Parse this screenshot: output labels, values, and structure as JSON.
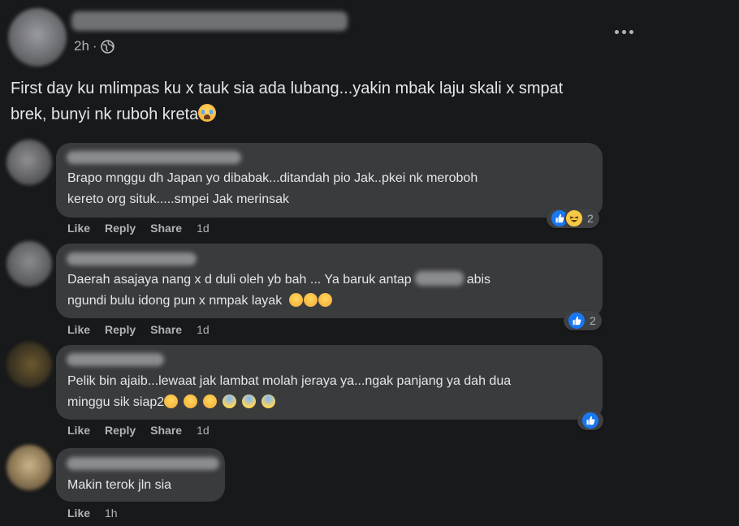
{
  "post": {
    "time": "2h",
    "dot": "·",
    "privacy_icon": "globe-icon",
    "text_line1": "First day ku mlimpas ku x tauk sia ada lubang...yakin mbak laju skali x smpat",
    "text_line2": "brek, bunyi nk ruboh kreta",
    "text_emoji": "crying-face-emoji",
    "more_icon": "more-horizontal-icon"
  },
  "actions": {
    "like": "Like",
    "reply": "Reply",
    "share": "Share"
  },
  "comments": [
    {
      "line1": "Brapo mnggu dh Japan yo dibabak...ditandah pio Jak..pkei nk meroboh",
      "line2": "kereto org situk.....smpei Jak merinsak",
      "time": "1d",
      "reaction_count": "2",
      "reactions": [
        "like",
        "haha"
      ]
    },
    {
      "line1_a": "Daerah asajaya nang x d duli oleh yb bah ... Ya baruk antap",
      "line1_b": "abis",
      "line2": "ngundi bulu idong pun x nmpak layak",
      "line2_emojis": [
        "rofl-emoji",
        "rofl-emoji",
        "rofl-emoji"
      ],
      "time": "1d",
      "reaction_count": "2",
      "reactions": [
        "like"
      ]
    },
    {
      "line1": "Pelik bin ajaib...lewaat jak lambat molah jeraya ya...ngak panjang ya dah dua",
      "line2": "minggu sik siap2",
      "line2_emojis": [
        "relieved-emoji",
        "relieved-emoji",
        "relieved-emoji",
        "scream-emoji",
        "scream-emoji",
        "scream-emoji"
      ],
      "time": "1d",
      "reactions": [
        "like"
      ]
    },
    {
      "line1": "Makin terok jln sia",
      "time": "1h"
    }
  ],
  "colors": {
    "background": "#18191a",
    "bubble": "#3a3b3c",
    "text": "#e4e6eb",
    "secondary": "#b0b3b8",
    "like_blue": "#1877f2"
  }
}
